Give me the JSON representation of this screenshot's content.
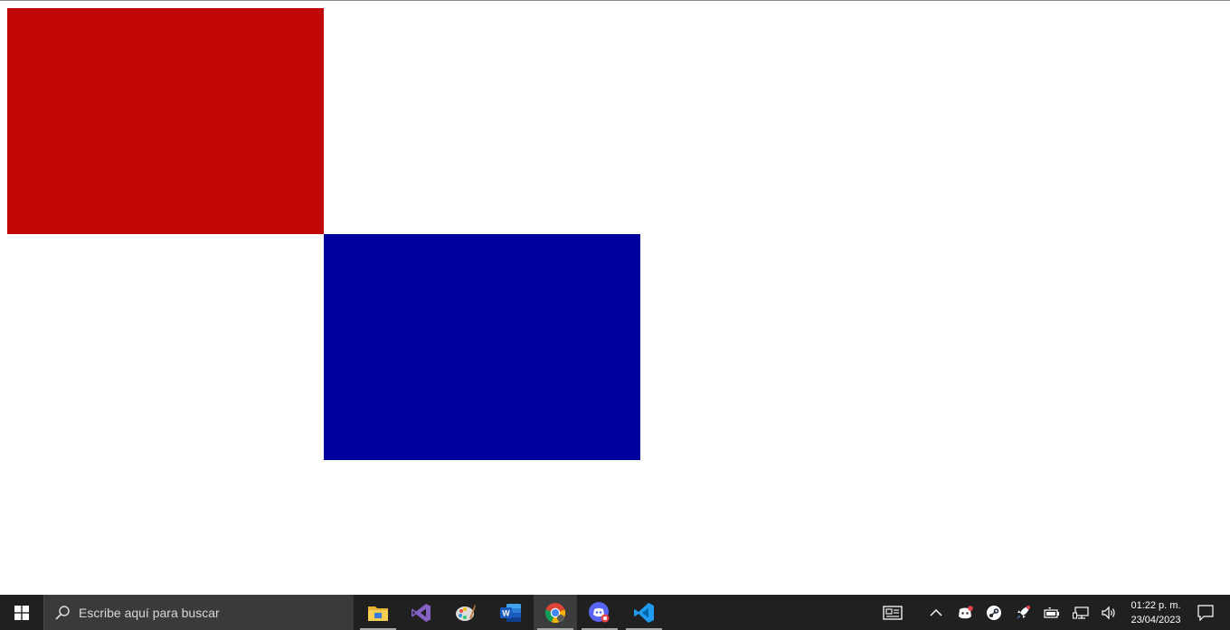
{
  "colors": {
    "red_box": "#c00606",
    "blue_box": "#00009c",
    "taskbar": "#202020"
  },
  "taskbar": {
    "search_placeholder": "Escribe aquí para buscar",
    "pinned_apps": [
      {
        "icon": "file-explorer-icon",
        "has_running_indicator": true
      },
      {
        "icon": "visual-studio-icon",
        "has_running_indicator": false
      },
      {
        "icon": "paint-icon",
        "has_running_indicator": false
      },
      {
        "icon": "word-icon",
        "has_running_indicator": false
      },
      {
        "icon": "chrome-icon",
        "has_running_indicator": true,
        "active": true
      },
      {
        "icon": "discord-app-icon",
        "has_running_indicator": true
      },
      {
        "icon": "vscode-icon",
        "has_running_indicator": true
      }
    ],
    "tray_icons": [
      "news-icon",
      "chevron-up-icon",
      "discord-tray-icon",
      "steam-icon",
      "rocket-icon",
      "battery-icon",
      "network-icon",
      "volume-icon"
    ],
    "clock": {
      "time": "01:22 p. m.",
      "date": "23/04/2023"
    }
  }
}
